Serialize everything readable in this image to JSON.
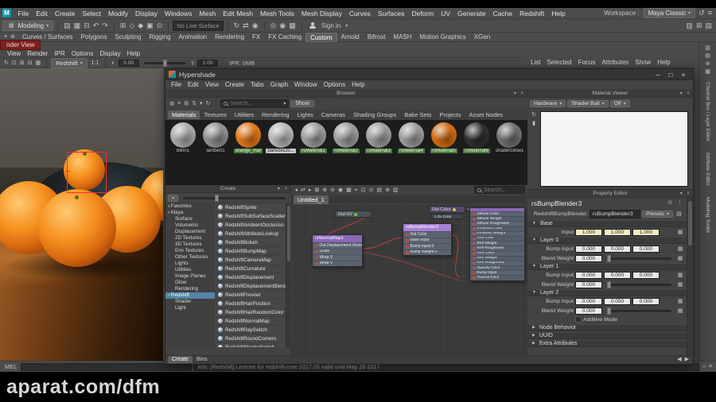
{
  "watermark": "aparat.com/dfm",
  "menubar": {
    "items": [
      "File",
      "Edit",
      "Create",
      "Select",
      "Modify",
      "Display",
      "Windows",
      "Mesh",
      "Edit Mesh",
      "Mesh Tools",
      "Mesh Display",
      "Curves",
      "Surfaces",
      "Deform",
      "UV",
      "Generate",
      "Cache",
      "Redshift",
      "Help"
    ],
    "workspace_label": "Workspace :",
    "workspace_value": "Maya Classic",
    "right_icons": [
      {
        "name": "workspace-reset-icon",
        "glyph": "↺"
      },
      {
        "name": "workspace-menu-icon",
        "glyph": "≡"
      }
    ]
  },
  "toolbar": {
    "mode_selector": "Modeling",
    "file_icons": [
      {
        "name": "new-scene-icon",
        "glyph": "▤"
      },
      {
        "name": "open-scene-icon",
        "glyph": "▦"
      },
      {
        "name": "save-scene-icon",
        "glyph": "⊟"
      },
      {
        "name": "undo-icon",
        "glyph": "↶"
      },
      {
        "name": "redo-icon",
        "glyph": "↷"
      }
    ],
    "snap_icons": [
      {
        "name": "snap-to-grid-icon",
        "glyph": "⊞"
      },
      {
        "name": "snap-to-curve-icon",
        "glyph": "◇"
      },
      {
        "name": "snap-to-point-icon",
        "glyph": "◆"
      },
      {
        "name": "snap-to-plane-icon",
        "glyph": "▣"
      },
      {
        "name": "make-live-icon",
        "glyph": "⊙"
      }
    ],
    "no_live_surface": "No Live Surface",
    "history_icons": [
      {
        "name": "construction-history-icon",
        "glyph": "↻"
      },
      {
        "name": "symmetry-icon",
        "glyph": "⇄"
      },
      {
        "name": "highlight-selection-icon",
        "glyph": "◉"
      }
    ],
    "render_icons": [
      {
        "name": "render-current-frame-icon",
        "glyph": "◎"
      },
      {
        "name": "ipr-render-icon",
        "glyph": "◉"
      },
      {
        "name": "render-settings-icon",
        "glyph": "▦"
      }
    ],
    "sign_in_label": "Sign in",
    "right_icons": [
      {
        "name": "viewport-layout-icon",
        "glyph": "▥"
      },
      {
        "name": "panel-layout-icon",
        "glyph": "⊞"
      },
      {
        "name": "outliner-toggle-icon",
        "glyph": "▤"
      }
    ]
  },
  "shelf": {
    "left_icons": [
      {
        "name": "shelf-menu-icon",
        "glyph": "≡"
      },
      {
        "name": "shelf-gear-icon",
        "glyph": "⊛"
      }
    ],
    "tabs": [
      "Curves / Surfaces",
      "Polygons",
      "Sculpting",
      "Rigging",
      "Animation",
      "Rendering",
      "FX",
      "FX Caching",
      "Custom",
      "Arnold",
      "Bifrost",
      "MASH",
      "Motion Graphics",
      "XGen"
    ],
    "active_tab": "Custom"
  },
  "render_view": {
    "torn_title": "nder View",
    "menu_items": [
      "View",
      "Render",
      "IPR",
      "Options",
      "Display",
      "Help"
    ],
    "toolbar_icons": [
      {
        "name": "redraw-region-icon",
        "glyph": "↻"
      },
      {
        "name": "snapshot-icon",
        "glyph": "⊡"
      },
      {
        "name": "keep-image-icon",
        "glyph": "⊞"
      },
      {
        "name": "remove-image-icon",
        "glyph": "⊟"
      },
      {
        "name": "open-render-settings-icon",
        "glyph": "▦"
      }
    ],
    "renderer": "Redshift",
    "display_ratio": "1:1",
    "exposure_value": "0.00",
    "gamma_value": "1.00",
    "ipr_status": "IPR: 0MB"
  },
  "attribute_editor": {
    "menu_items": [
      "List",
      "Selected",
      "Focus",
      "Attributes",
      "Show",
      "Help"
    ]
  },
  "hypershade": {
    "title": "Hypershade",
    "window_buttons": [
      {
        "name": "minimize-button-icon",
        "glyph": "─"
      },
      {
        "name": "maximize-button-icon",
        "glyph": "□"
      },
      {
        "name": "close-button-icon",
        "glyph": "×"
      }
    ],
    "menu_items": [
      "File",
      "Edit",
      "View",
      "Create",
      "Tabs",
      "Graph",
      "Window",
      "Options",
      "Help"
    ],
    "browser": {
      "title": "Browser",
      "toolbar_icons": [
        {
          "name": "swatch-size-icon",
          "glyph": "◍"
        },
        {
          "name": "list-view-icon",
          "glyph": "≡"
        },
        {
          "name": "grid-view-icon",
          "glyph": "⊞"
        },
        {
          "name": "sort-icon",
          "glyph": "⇅"
        },
        {
          "name": "filter-icon",
          "glyph": "▾"
        },
        {
          "name": "refresh-swatches-icon",
          "glyph": "↻"
        }
      ],
      "search_placeholder": "Search...",
      "show_button": "Show",
      "tabs": [
        "Materials",
        "Textures",
        "Utilities",
        "Rendering",
        "Lights",
        "Cameras",
        "Shading Groups",
        "Bake Sets",
        "Projects",
        "Asset Nodes"
      ],
      "active_tab": "Materials",
      "swatches": [
        {
          "name": "blinn1",
          "color": "#a8a8a8",
          "label_bg": "dark"
        },
        {
          "name": "lambert1",
          "color": "#8f8f8f",
          "label_bg": "dark"
        },
        {
          "name": "orange_mat",
          "color": "#e0761a",
          "label_bg": "green"
        },
        {
          "name": "particleClo...",
          "color": "#b5b5b5",
          "label_bg": "light"
        },
        {
          "name": "rsMaterial1",
          "color": "#9b9b9b",
          "label_bg": "green"
        },
        {
          "name": "rsMaterial2",
          "color": "#9b9b9b",
          "label_bg": "green"
        },
        {
          "name": "rsMaterial3",
          "color": "#9b9b9b",
          "label_bg": "green"
        },
        {
          "name": "rsMaterial4",
          "color": "#9b9b9b",
          "label_bg": "green"
        },
        {
          "name": "rsMaterial5",
          "color": "#cf6a12",
          "label_bg": "green"
        },
        {
          "name": "rsMaterial6",
          "color": "#303030",
          "label_bg": "green"
        },
        {
          "name": "shaderGlow1",
          "color": "#6f6f6f",
          "label_bg": "dark"
        }
      ]
    },
    "create_panel": {
      "header": "Create",
      "categories": [
        {
          "label": "Favorites",
          "indent": 0
        },
        {
          "label": "Maya",
          "indent": 0
        },
        {
          "label": "Surface",
          "indent": 1
        },
        {
          "label": "Volumetric",
          "indent": 1
        },
        {
          "label": "Displacement",
          "indent": 1
        },
        {
          "label": "2D Textures",
          "indent": 1
        },
        {
          "label": "3D Textures",
          "indent": 1
        },
        {
          "label": "Env Textures",
          "indent": 1
        },
        {
          "label": "Other Textures",
          "indent": 1
        },
        {
          "label": "Lights",
          "indent": 1
        },
        {
          "label": "Utilities",
          "indent": 1
        },
        {
          "label": "Image Planes",
          "indent": 1
        },
        {
          "label": "Glow",
          "indent": 1
        },
        {
          "label": "Rendering",
          "indent": 1
        },
        {
          "label": "Redshift",
          "indent": 0
        },
        {
          "label": "Shader",
          "indent": 1
        },
        {
          "label": "Light",
          "indent": 1
        }
      ],
      "active_category": "Redshift",
      "nodes": [
        "RedshiftSprite",
        "RedshiftSubSurfaceScatter",
        "RedshiftAmbientOcclusion",
        "RedshiftAttributeLookup",
        "RedshiftBokeh",
        "RedshiftBumpMap",
        "RedshiftCameraMap",
        "RedshiftCurvature",
        "RedshiftDisplacement",
        "RedshiftDisplacementBlender",
        "RedshiftFresnel",
        "RedshiftHairPosition",
        "RedshiftHairRandomColor",
        "RedshiftNormalMap",
        "RedshiftRaySwitch",
        "RedshiftRoundCorners",
        "RedshiftShaderSwitch"
      ],
      "bottom_tabs": [
        "Create",
        "Bins"
      ],
      "active_bottom_tab": "Create"
    },
    "work_area": {
      "toolbar_icons": [
        {
          "name": "input-connections-icon",
          "glyph": "◂"
        },
        {
          "name": "input-output-connections-icon",
          "glyph": "⇄"
        },
        {
          "name": "output-connections-icon",
          "glyph": "▸"
        },
        {
          "name": "clear-graph-icon",
          "glyph": "⊠"
        },
        {
          "name": "add-selected-icon",
          "glyph": "⊕"
        },
        {
          "name": "remove-selected-icon",
          "glyph": "⊖"
        },
        {
          "name": "graph-materials-icon",
          "glyph": "◉"
        },
        {
          "name": "rearrange-graph-icon",
          "glyph": "▦"
        },
        {
          "name": "frame-all-icon",
          "glyph": "⌖"
        },
        {
          "name": "frame-selection-icon",
          "glyph": "⊡"
        },
        {
          "name": "pin-node-icon",
          "glyph": "⊙"
        },
        {
          "name": "grid-toggle-icon",
          "glyph": "▤"
        },
        {
          "name": "snap-toggle-icon",
          "glyph": "⊛"
        },
        {
          "name": "bookmarks-icon",
          "glyph": "▥"
        }
      ],
      "search_placeholder": "Search...",
      "tab": "Untitled_1",
      "out_uv_label": "Out UV",
      "out_color_label": "Out Color",
      "ov_color_label": "1 Ov Color",
      "material_rows": [
        "Diffuse Color",
        "Diffuse Weight",
        "Diffuse Roughness",
        "Emission Color",
        "Emission Weight",
        "Refl Color",
        "Refl Weight",
        "Refl Roughness",
        "Refr Color",
        "Refr Weight",
        "Refr Roughness",
        "Opacity Color",
        "Bump Input",
        "Overall Color"
      ],
      "normal_map": {
        "title": "rsNormalMap1",
        "rows": [
          "Out Displacement Vector",
          "Scale",
          "Wrap U",
          "Wrap V"
        ]
      },
      "bump_blender": {
        "title": "rsBumpBlender3",
        "rows": [
          "Out Color",
          "Base Input",
          "Bump Input 0",
          "Bump Weight 0"
        ]
      }
    },
    "material_viewer": {
      "title": "Material Viewer",
      "renderer_dropdown": "Hardware",
      "geometry_dropdown": "Shader Ball",
      "env_dropdown": "Off",
      "side_icons": [
        {
          "name": "viewer-refresh-icon",
          "glyph": "↻"
        },
        {
          "name": "viewer-pause-icon",
          "glyph": "▮"
        }
      ]
    },
    "property_editor": {
      "title": "Property Editor",
      "node_name": "rsBumpBlender3",
      "type_label": "RedshiftBumpBlender:",
      "type_value": "rsBumpBlender3",
      "presets_button": "Presets",
      "base_label": "Base",
      "input_label": "Input",
      "input_values": [
        "1.000",
        "1.000",
        "1.000"
      ],
      "layers": [
        {
          "label": "Layer 0",
          "bump_label": "Bump Input",
          "bump_values": [
            "0.000",
            "0.000",
            "0.000"
          ],
          "blend_label": "Blend Weight",
          "blend_value": "0.000"
        },
        {
          "label": "Layer 1",
          "bump_label": "Bump Input",
          "bump_values": [
            "0.000",
            "0.000",
            "0.000"
          ],
          "blend_label": "Blend Weight",
          "blend_value": "0.000"
        },
        {
          "label": "Layer 2",
          "bump_label": "Bump Input",
          "bump_values": [
            "0.000",
            "0.000",
            "0.000"
          ],
          "blend_label": "Blend Weight",
          "blend_value": "0.000"
        }
      ],
      "additive_mode_label": "Additive Mode",
      "collapsed_sections": [
        "Node Behavior",
        "UUID",
        "Extra Attributes"
      ]
    },
    "pager_icons": [
      {
        "name": "previous-page-icon",
        "glyph": "◀"
      },
      {
        "name": "next-page-icon",
        "glyph": "▶"
      }
    ]
  },
  "right_dock": {
    "icons": [
      {
        "name": "show-channel-box-icon",
        "glyph": "▥"
      },
      {
        "name": "show-attribute-editor-icon",
        "glyph": "▤"
      },
      {
        "name": "show-tool-settings-icon",
        "glyph": "⊛"
      },
      {
        "name": "show-modeling-toolkit-icon",
        "glyph": "▦"
      }
    ],
    "tabs": [
      "Channel Box / Layer Editor",
      "Attribute Editor",
      "Modeling Toolkit"
    ]
  },
  "status_bar": {
    "mel_label": "MEL",
    "info_message": "Info: [Redshift] License for redshift-core 2017.05 valid until May 28 2017",
    "right_icons": [
      {
        "name": "script-editor-icon",
        "glyph": "⌂"
      },
      {
        "name": "command-history-icon",
        "glyph": "≡"
      }
    ]
  }
}
